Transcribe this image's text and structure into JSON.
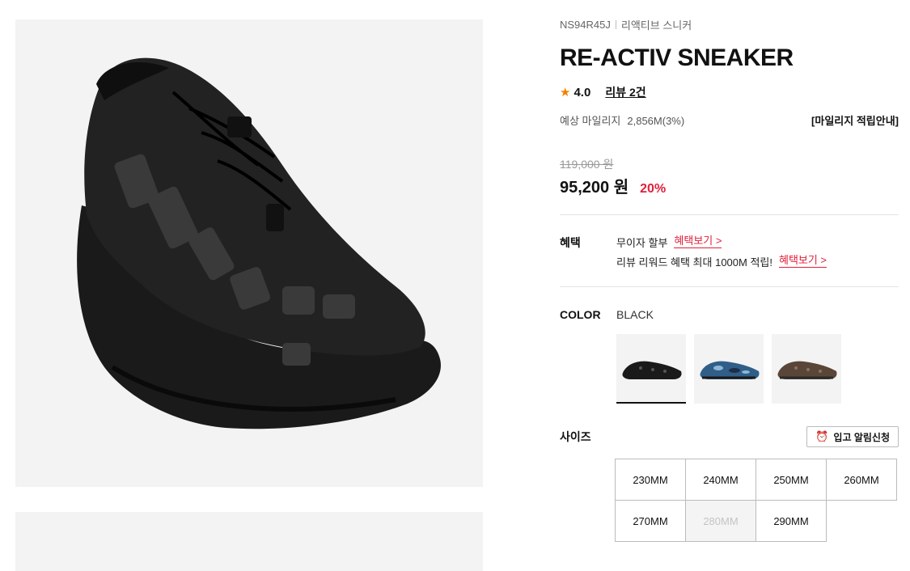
{
  "product": {
    "code": "NS94R45J",
    "name_ko": "리액티브 스니커",
    "title": "RE-ACTIV SNEAKER",
    "rating": "4.0",
    "review_link": "리뷰 2건",
    "star_color": "#f08200"
  },
  "mileage": {
    "label": "예상 마일리지",
    "value": "2,856M(3%)",
    "guide_link": "[마일리지 적립안내]"
  },
  "price": {
    "original": "119,000 원",
    "sale": "95,200 원",
    "discount": "20%",
    "discount_color": "#e0203a"
  },
  "benefit": {
    "label": "혜택",
    "lines": [
      {
        "text": "무이자 할부",
        "link": "혜택보기 >"
      },
      {
        "text": "리뷰 리워드 혜택 최대 1000M 적립!",
        "link": "혜택보기 >"
      }
    ]
  },
  "color": {
    "label": "COLOR",
    "selected": "BLACK",
    "swatches": [
      {
        "icon": "black-shoe-thumbnail",
        "selected": true
      },
      {
        "icon": "blue-camo-shoe-thumbnail",
        "selected": false
      },
      {
        "icon": "brown-shoe-thumbnail",
        "selected": false
      }
    ]
  },
  "size": {
    "label": "사이즈",
    "restock_button": "입고 알림신청",
    "options": [
      {
        "label": "230MM",
        "soldout": false
      },
      {
        "label": "240MM",
        "soldout": false
      },
      {
        "label": "250MM",
        "soldout": false
      },
      {
        "label": "260MM",
        "soldout": false
      },
      {
        "label": "270MM",
        "soldout": false
      },
      {
        "label": "280MM",
        "soldout": true
      },
      {
        "label": "290MM",
        "soldout": false
      }
    ]
  }
}
